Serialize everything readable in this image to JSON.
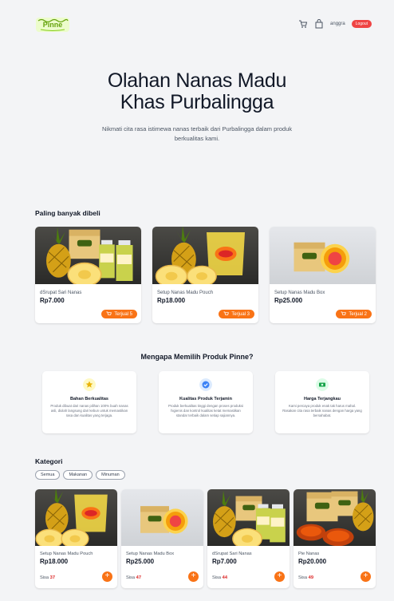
{
  "nav": {
    "logo_text": "Pinne",
    "cart_icon": "cart-icon",
    "bag_icon": "shopping-bag-icon",
    "username": "anggra",
    "logout_label": "Logout"
  },
  "hero": {
    "title_line1": "Olahan Nanas Madu",
    "title_line2": "Khas Purbalingga",
    "subtitle": "Nikmati cita rasa istimewa nanas terbaik dari Purbalingga dalam produk berkualitas kami."
  },
  "best_sellers": {
    "title": "Paling banyak dibeli",
    "items": [
      {
        "name": "dSrupat Sari Nanas",
        "price": "Rp7.000",
        "sold": "Terjual 5"
      },
      {
        "name": "Setup Nanas Madu Pouch",
        "price": "Rp18.000",
        "sold": "Terjual 3"
      },
      {
        "name": "Setup Nanas Madu Box",
        "price": "Rp25.000",
        "sold": "Terjual 2"
      }
    ]
  },
  "why": {
    "title": "Mengapa Memilih Produk Pinne?",
    "items": [
      {
        "title": "Bahan Berkualitas",
        "desc": "Produk dibuat dari nanas pilihan 100% buah nanas asli, diolah langsung dari kebun untuk memastikan rasa dan kualitas yang terjaga.",
        "icon": "star-icon",
        "color": "#facc15",
        "bg": "#fef9c3"
      },
      {
        "title": "Kualitas Produk Terjamin",
        "desc": "Produk berkualitas tinggi dengan proses produksi higienis dan kontrol kualitas ketat memastikan standar terbaik dalam setiap sajiannya.",
        "icon": "check-badge-icon",
        "color": "#3b82f6",
        "bg": "#dbeafe"
      },
      {
        "title": "Harga Terjangkau",
        "desc": "Kami percaya produk enak tak harus mahal. Rasakan cita rasa terbaik nanas dengan harga yang bersahabat.",
        "icon": "money-icon",
        "color": "#16a34a",
        "bg": "#dcfce7"
      }
    ]
  },
  "categories": {
    "title": "Kategori",
    "chips": [
      "Semua",
      "Makanan",
      "Minuman"
    ]
  },
  "products": [
    {
      "name": "Setup Nanas Madu Pouch",
      "price": "Rp18.000",
      "stock_label": "Sisa",
      "stock": "37"
    },
    {
      "name": "Setup Nanas Madu Box",
      "price": "Rp25.000",
      "stock_label": "Sisa",
      "stock": "47"
    },
    {
      "name": "dSrupat Sari Nanas",
      "price": "Rp7.000",
      "stock_label": "Sisa",
      "stock": "44"
    },
    {
      "name": "Pie Nanas",
      "price": "Rp20.000",
      "stock_label": "Sisa",
      "stock": "49"
    }
  ],
  "colors": {
    "accent": "#f97316",
    "logout": "#ef4444",
    "stock": "#dc2626",
    "logo": "#65a30d"
  }
}
